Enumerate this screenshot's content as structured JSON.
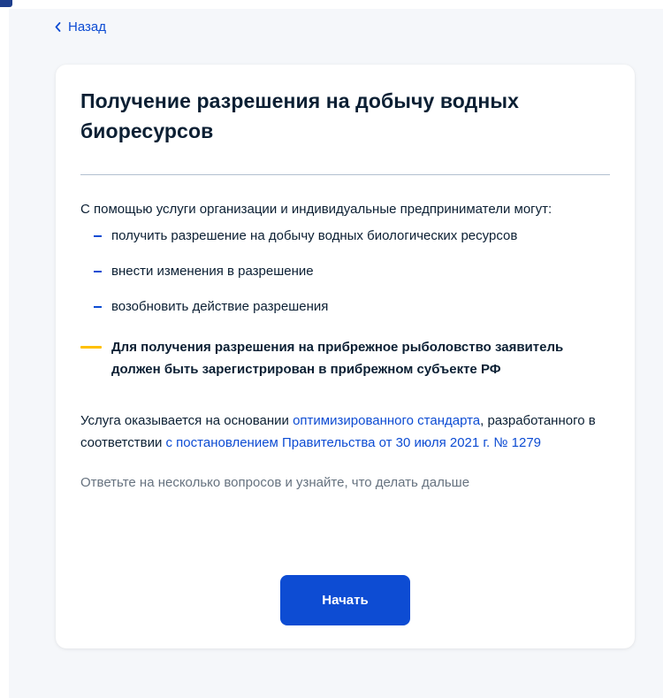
{
  "nav": {
    "back_label": "Назад"
  },
  "card": {
    "title": "Получение разрешения на добычу водных биоресурсов",
    "intro": "С помощью услуги организации и индивидуальные предприниматели могут:",
    "list_items": [
      "получить разрешение на добычу водных биологических ресурсов",
      "внести изменения в разрешение",
      "возобновить действие разрешения"
    ],
    "notice": "Для получения разрешения на прибрежное рыболовство заявитель должен быть зарегистрирован в прибрежном субъекте РФ",
    "basis": {
      "text_before": "Услуга оказывается на основании ",
      "link_standard": "оптимизированного стандарта",
      "text_middle": ", разработанного в соответствии ",
      "link_decree": "с постановлением Правительства от 30 июля 2021 г. № 1279"
    },
    "hint": "Ответьте на несколько вопросов и узнайте, что делать дальше",
    "start_label": "Начать"
  },
  "colors": {
    "accent": "#0d4cd3",
    "warning_bar": "#ffc000",
    "background": "#f5f7fa",
    "text": "#0b1f33",
    "muted_text": "#66727f"
  },
  "icons": {
    "back": "chevron-left-icon",
    "bullet": "dash-icon",
    "notice": "yellow-bar-icon"
  }
}
